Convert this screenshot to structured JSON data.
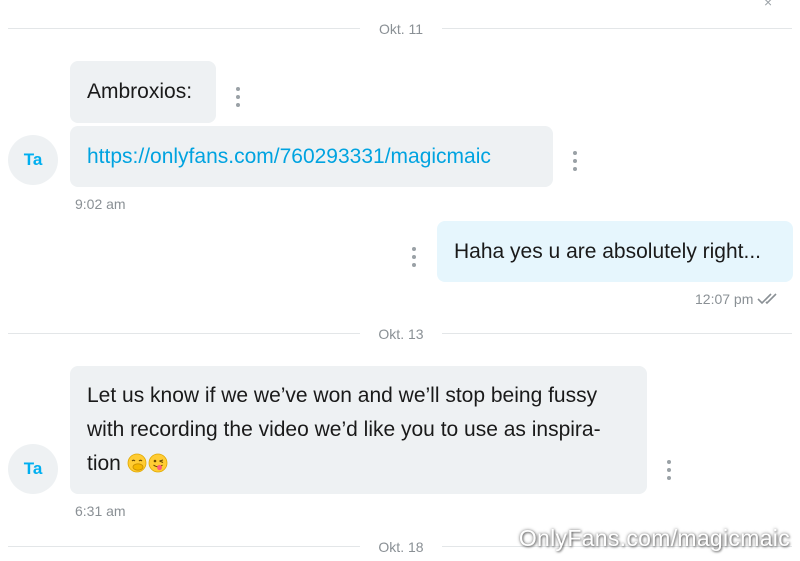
{
  "top_close_glyph": "×",
  "date_separators": [
    "Okt. 11",
    "Okt. 13",
    "Okt. 18"
  ],
  "messages": [
    {
      "sender_initials": "Ta",
      "lines": [
        "Ambroxios:",
        "https://onlyfans.com/760293331/magicmaic"
      ],
      "time": "9:02 am"
    },
    {
      "outgoing": true,
      "text": "Haha yes u are absolutely right...",
      "time": "12:07 pm",
      "status_icon": "double-check-icon"
    },
    {
      "sender_initials": "Ta",
      "text_lines": [
        "Let us know if we we’ve won and we’ll stop being fussy",
        "with recording the video we’d like you to use as inspira-",
        "tion"
      ],
      "emojis": [
        "face-with-hand-over-mouth-emoji",
        "winking-face-with-tongue-emoji"
      ],
      "time": "6:31 am"
    }
  ],
  "watermark": "OnlyFans.com/magicmaic",
  "colors": {
    "link": "#00a3e0",
    "avatar_text": "#00aff0",
    "incoming_bubble": "#eef1f3",
    "outgoing_bubble": "#e6f6fd"
  }
}
